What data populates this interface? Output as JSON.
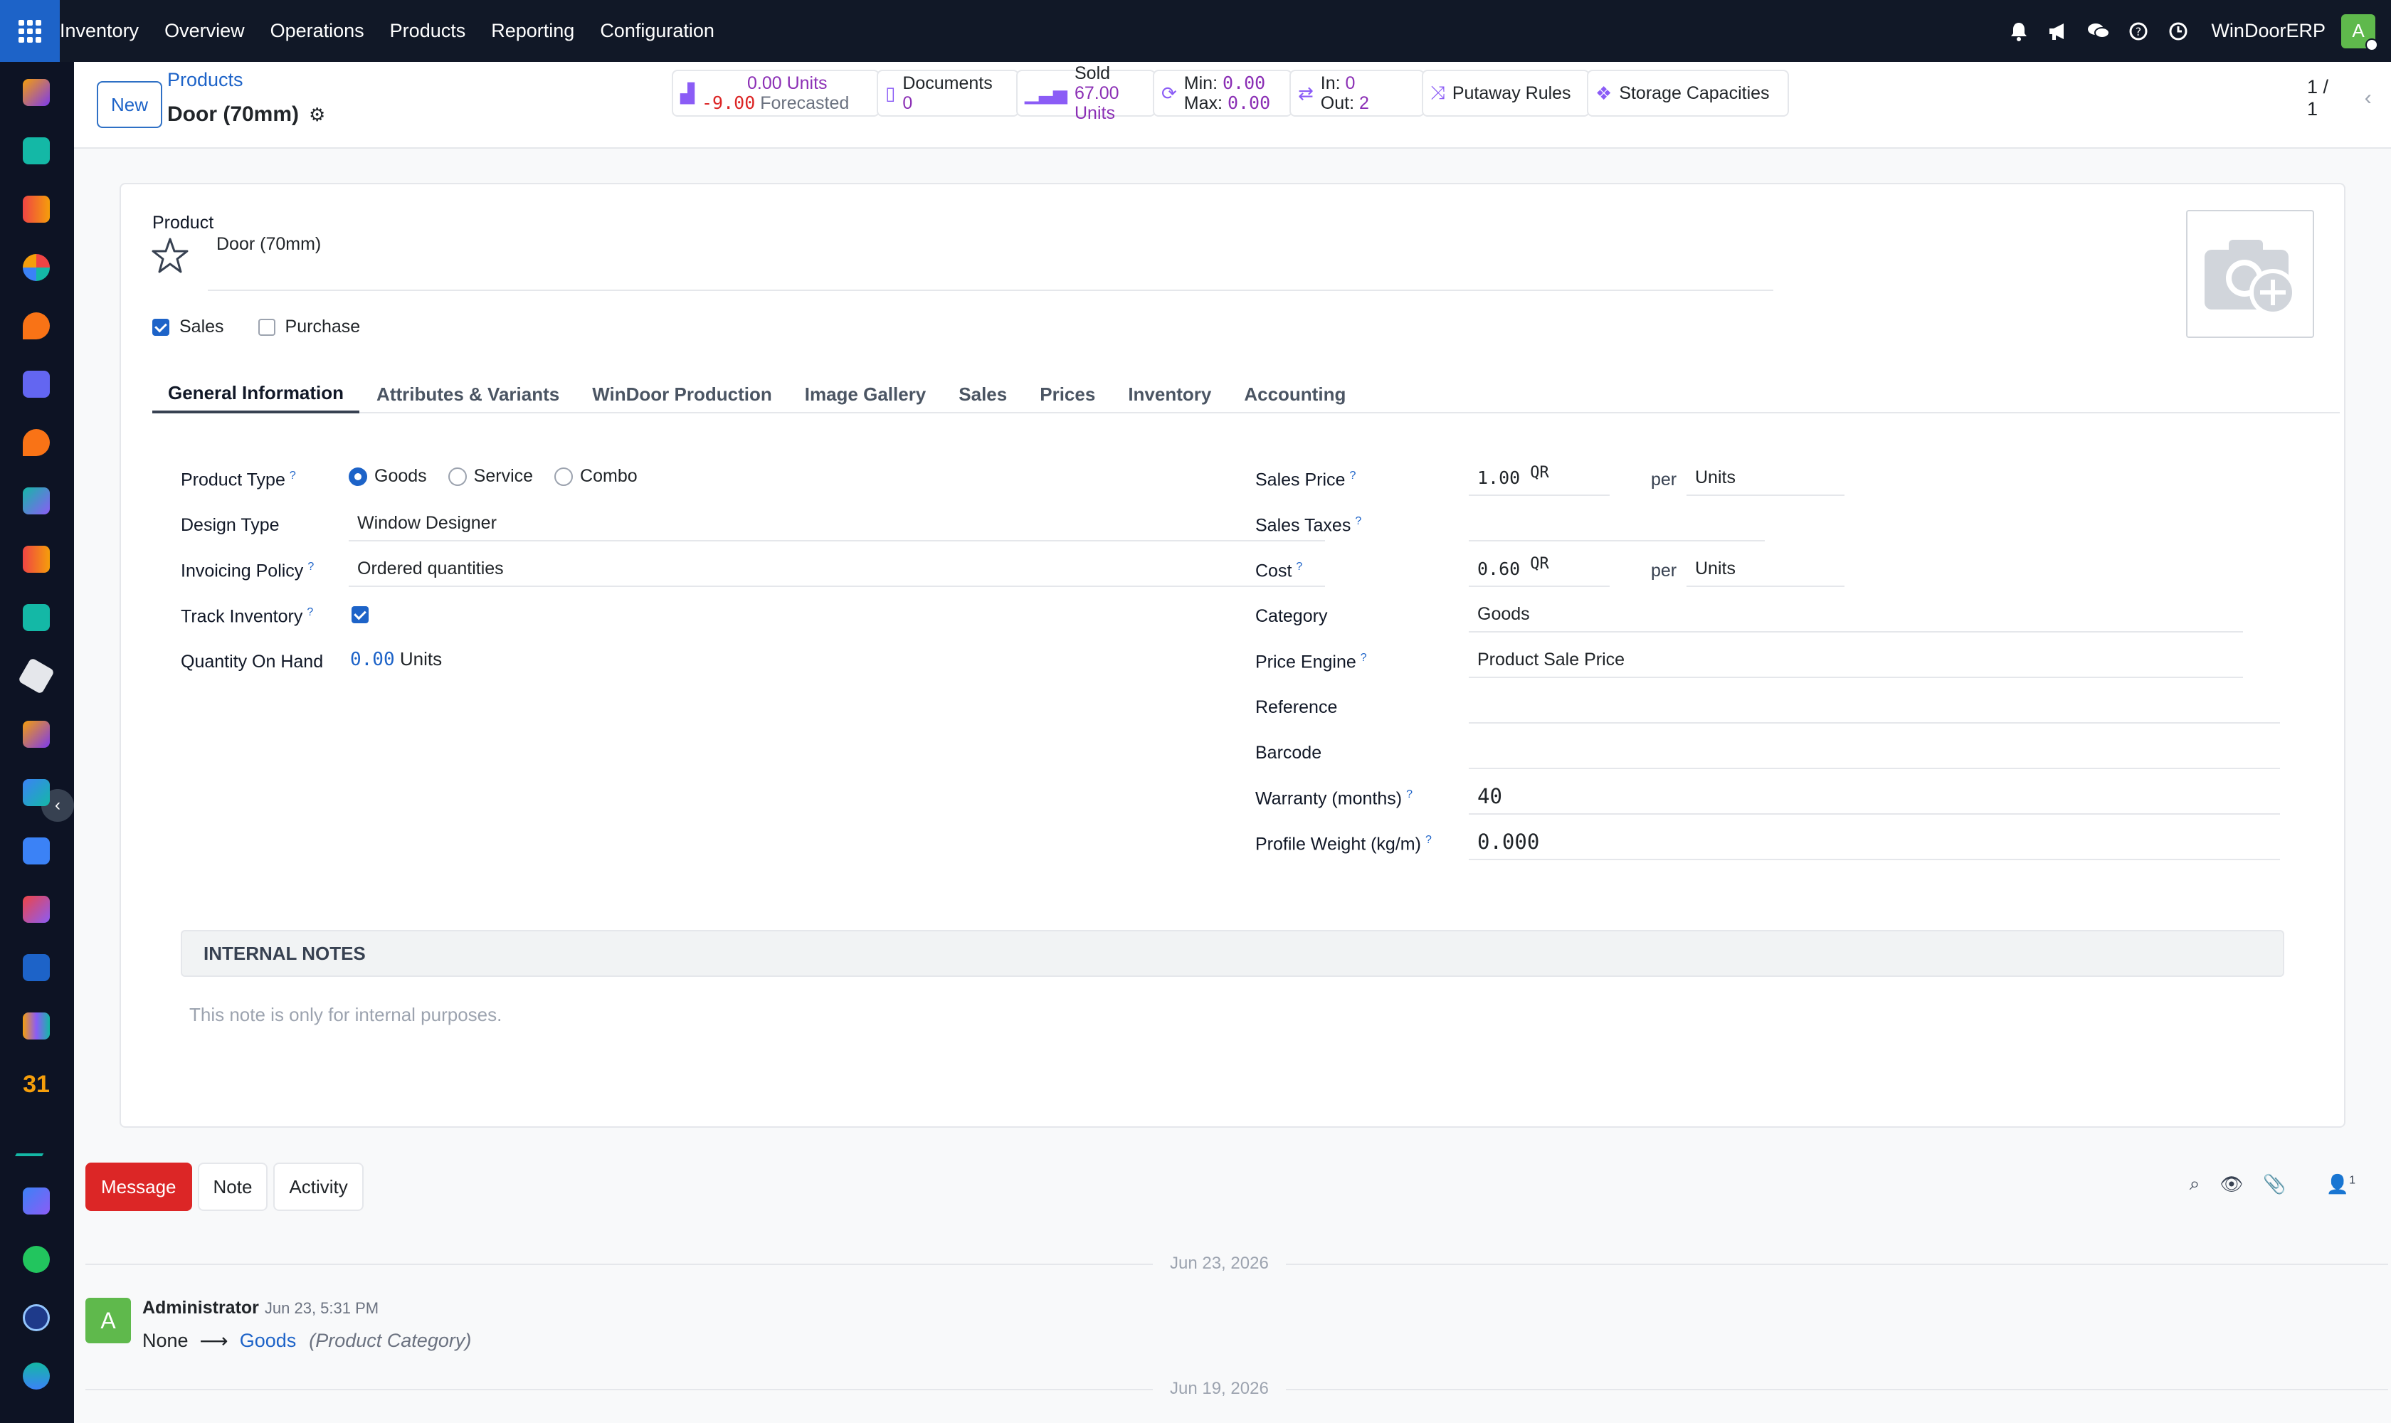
{
  "topbar": {
    "menu": [
      "Inventory",
      "Overview",
      "Operations",
      "Products",
      "Reporting",
      "Configuration"
    ],
    "company": "WinDoorERP",
    "avatar": "A",
    "icons": [
      "bell-icon",
      "megaphone-icon",
      "chat-icon",
      "help-icon",
      "clock-icon"
    ]
  },
  "sidebar": {
    "apps": [
      "app-icon-1",
      "app-icon-2",
      "app-icon-3",
      "app-icon-4",
      "app-icon-5",
      "app-icon-6",
      "app-icon-7",
      "app-icon-8",
      "app-icon-9",
      "app-icon-10",
      "app-icon-11",
      "app-icon-12",
      "app-icon-13",
      "app-icon-14",
      "app-icon-15",
      "app-icon-16",
      "app-icon-17",
      "calendar-icon",
      "app-icon-19",
      "app-icon-20",
      "whatsapp-icon",
      "app-icon-22",
      "app-icon-23"
    ],
    "calendar_label": "31"
  },
  "controlpanel": {
    "new_label": "New",
    "breadcrumb": "Products",
    "record_title": "Door (70mm)",
    "pager": "1 / 1",
    "smart": {
      "onhand_units": "0.00 Units",
      "forecast_num": "-9.00",
      "forecast_label": "Forecasted",
      "documents_label": "Documents",
      "documents_count": "0",
      "sold_label": "Sold",
      "sold_value": "67.00 Units",
      "min_label": "Min:",
      "min_value": "0.00",
      "max_label": "Max:",
      "max_value": "0.00",
      "in_label": "In:",
      "in_value": "0",
      "out_label": "Out:",
      "out_value": "2",
      "putaway": "Putaway Rules",
      "storage": "Storage Capacities"
    }
  },
  "form": {
    "product_label": "Product",
    "product_name": "Door (70mm)",
    "sales_label": "Sales",
    "sales_checked": true,
    "purchase_label": "Purchase",
    "purchase_checked": false,
    "tabs": [
      "General Information",
      "Attributes & Variants",
      "WinDoor Production",
      "Image Gallery",
      "Sales",
      "Prices",
      "Inventory",
      "Accounting"
    ],
    "active_tab": "General Information",
    "left": {
      "product_type_label": "Product Type",
      "product_type_options": [
        "Goods",
        "Service",
        "Combo"
      ],
      "product_type_value": "Goods",
      "design_type_label": "Design Type",
      "design_type_value": "Window Designer",
      "invoicing_label": "Invoicing Policy",
      "invoicing_value": "Ordered quantities",
      "track_label": "Track Inventory",
      "qoh_label": "Quantity On Hand",
      "qoh_value": "0.00",
      "qoh_unit": "Units"
    },
    "right": {
      "sales_price_label": "Sales Price",
      "sales_price_value": "1.00",
      "currency": "QR",
      "per": "per",
      "unit": "Units",
      "taxes_label": "Sales Taxes",
      "cost_label": "Cost",
      "cost_value": "0.60",
      "category_label": "Category",
      "category_value": "Goods",
      "price_engine_label": "Price Engine",
      "price_engine_value": "Product Sale Price",
      "reference_label": "Reference",
      "barcode_label": "Barcode",
      "warranty_label": "Warranty (months)",
      "warranty_value": "40",
      "weight_label": "Profile Weight (kg/m)",
      "weight_value": "0.000"
    },
    "notes_header": "INTERNAL NOTES",
    "notes_placeholder": "This note is only for internal purposes."
  },
  "chatter": {
    "message_btn": "Message",
    "note_btn": "Note",
    "activity_btn": "Activity",
    "followers_count": "1",
    "date1": "Jun 23, 2026",
    "date2": "Jun 19, 2026",
    "author": "Administrator",
    "time": "Jun 23, 5:31 PM",
    "old_value": "None",
    "new_value": "Goods",
    "field_name": "(Product Category)",
    "author_initial": "A"
  },
  "colors": {
    "topbar": "#111827",
    "sidebar": "#0d1324",
    "accent": "#1d63c8",
    "danger": "#dc2626",
    "smart_value": "#8b2fb5"
  }
}
